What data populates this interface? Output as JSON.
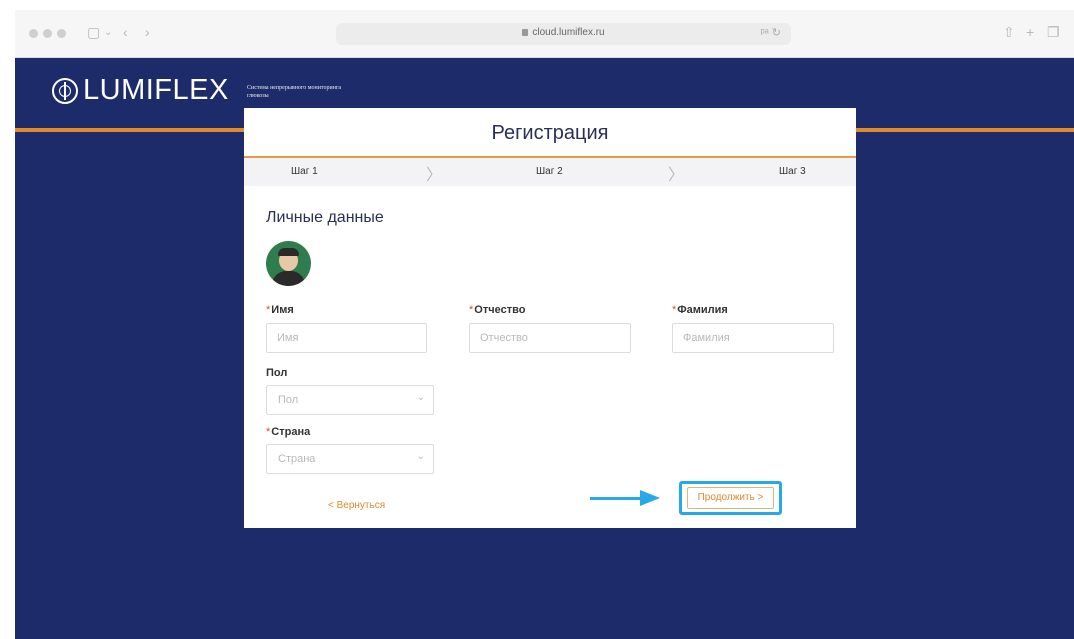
{
  "browser": {
    "url": "cloud.lumiflex.ru",
    "right_icons": "ᵖᵃ ↻"
  },
  "header": {
    "logo_text": "LUMIFLEX",
    "tagline": "Система непрерывного мониторинга глюкозы"
  },
  "card": {
    "title": "Регистрация",
    "steps": [
      "Шаг 1",
      "Шаг 2",
      "Шаг 3"
    ],
    "section_title": "Личные данные",
    "fields": {
      "first_name": {
        "label": "Имя",
        "placeholder": "Имя",
        "required": true
      },
      "patronymic": {
        "label": "Отчество",
        "placeholder": "Отчество",
        "required": true
      },
      "last_name": {
        "label": "Фамилия",
        "placeholder": "Фамилия",
        "required": true
      },
      "gender": {
        "label": "Пол",
        "placeholder": "Пол",
        "required": false
      },
      "country": {
        "label": "Страна",
        "placeholder": "Страна",
        "required": true
      }
    },
    "back_label": "< Вернуться",
    "continue_label": "Продолжить >"
  },
  "colors": {
    "background": "#1d2b6b",
    "accent_orange": "#e08a2e",
    "highlight_blue": "#27a9e8"
  }
}
